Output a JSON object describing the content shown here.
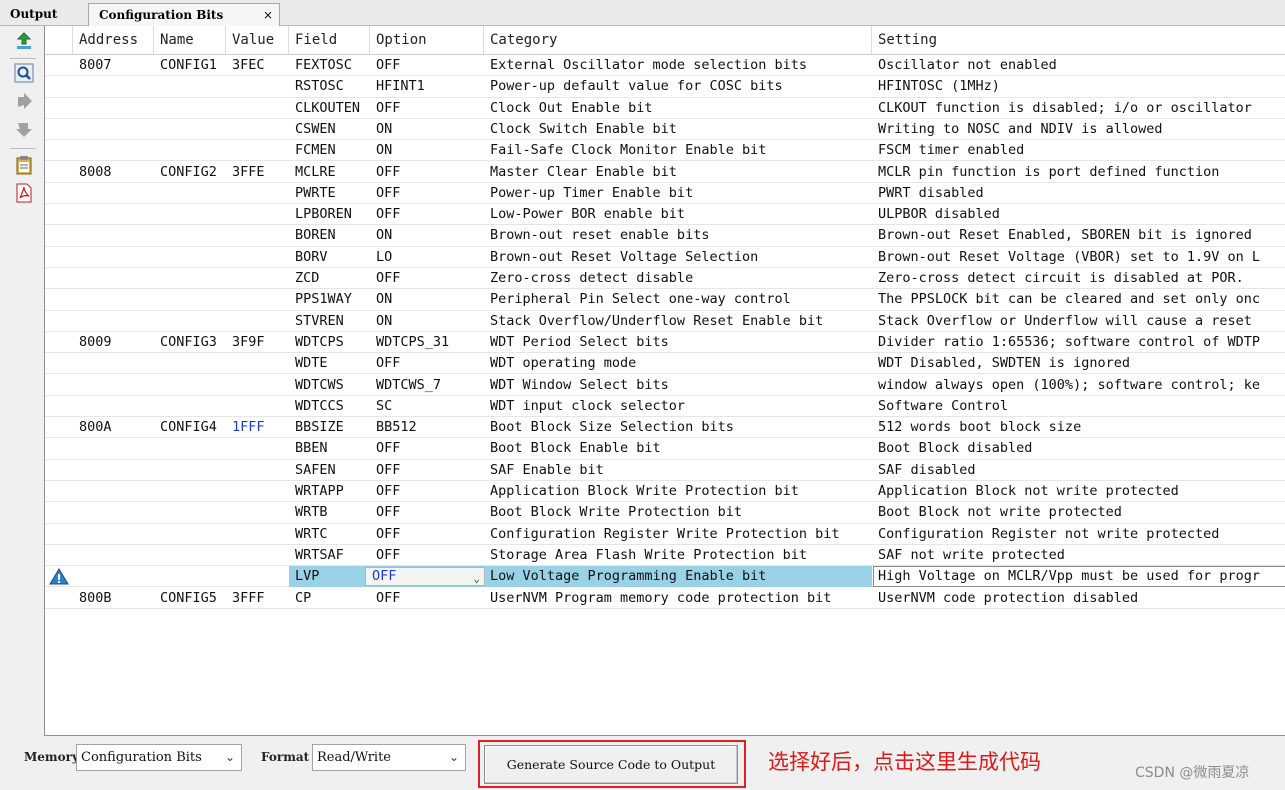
{
  "tabs": [
    {
      "label": "Output"
    },
    {
      "label": "Configuration Bits",
      "close": "×"
    }
  ],
  "columns": [
    "Address",
    "Name",
    "Value",
    "Field",
    "Option",
    "Category",
    "Setting"
  ],
  "rows": [
    {
      "address": "8007",
      "name": "CONFIG1",
      "value": "3FEC",
      "field": "FEXTOSC",
      "option": "OFF",
      "category": "External Oscillator mode selection bits",
      "setting": "Oscillator not enabled"
    },
    {
      "address": "",
      "name": "",
      "value": "",
      "field": "RSTOSC",
      "option": "HFINT1",
      "category": "Power-up default value for COSC bits",
      "setting": "HFINTOSC (1MHz)"
    },
    {
      "address": "",
      "name": "",
      "value": "",
      "field": "CLKOUTEN",
      "option": "OFF",
      "category": "Clock Out Enable bit",
      "setting": "CLKOUT function is disabled; i/o or oscillator"
    },
    {
      "address": "",
      "name": "",
      "value": "",
      "field": "CSWEN",
      "option": "ON",
      "category": "Clock Switch Enable bit",
      "setting": "Writing to NOSC and NDIV is allowed"
    },
    {
      "address": "",
      "name": "",
      "value": "",
      "field": "FCMEN",
      "option": "ON",
      "category": "Fail-Safe Clock Monitor Enable bit",
      "setting": "FSCM timer enabled"
    },
    {
      "address": "8008",
      "name": "CONFIG2",
      "value": "3FFE",
      "field": "MCLRE",
      "option": "OFF",
      "category": "Master Clear Enable bit",
      "setting": "MCLR pin function is port defined function"
    },
    {
      "address": "",
      "name": "",
      "value": "",
      "field": "PWRTE",
      "option": "OFF",
      "category": "Power-up Timer Enable bit",
      "setting": "PWRT disabled"
    },
    {
      "address": "",
      "name": "",
      "value": "",
      "field": "LPBOREN",
      "option": "OFF",
      "category": "Low-Power BOR enable bit",
      "setting": "ULPBOR disabled"
    },
    {
      "address": "",
      "name": "",
      "value": "",
      "field": "BOREN",
      "option": "ON",
      "category": "Brown-out reset enable bits",
      "setting": "Brown-out Reset Enabled, SBOREN bit is ignored"
    },
    {
      "address": "",
      "name": "",
      "value": "",
      "field": "BORV",
      "option": "LO",
      "category": "Brown-out Reset Voltage Selection",
      "setting": "Brown-out Reset Voltage (VBOR) set to 1.9V on L"
    },
    {
      "address": "",
      "name": "",
      "value": "",
      "field": "ZCD",
      "option": "OFF",
      "category": "Zero-cross detect disable",
      "setting": "Zero-cross detect circuit is disabled at POR."
    },
    {
      "address": "",
      "name": "",
      "value": "",
      "field": "PPS1WAY",
      "option": "ON",
      "category": "Peripheral Pin Select one-way control",
      "setting": "The PPSLOCK bit can be cleared and set only onc"
    },
    {
      "address": "",
      "name": "",
      "value": "",
      "field": "STVREN",
      "option": "ON",
      "category": "Stack Overflow/Underflow Reset Enable bit",
      "setting": "Stack Overflow or Underflow will cause a reset"
    },
    {
      "address": "8009",
      "name": "CONFIG3",
      "value": "3F9F",
      "field": "WDTCPS",
      "option": "WDTCPS_31",
      "category": "WDT Period Select bits",
      "setting": "Divider ratio 1:65536; software control of WDTP"
    },
    {
      "address": "",
      "name": "",
      "value": "",
      "field": "WDTE",
      "option": "OFF",
      "category": "WDT operating mode",
      "setting": "WDT Disabled, SWDTEN is ignored"
    },
    {
      "address": "",
      "name": "",
      "value": "",
      "field": "WDTCWS",
      "option": "WDTCWS_7",
      "category": "WDT Window Select bits",
      "setting": "window always open (100%); software control; ke"
    },
    {
      "address": "",
      "name": "",
      "value": "",
      "field": "WDTCCS",
      "option": "SC",
      "category": "WDT input clock selector",
      "setting": "Software Control"
    },
    {
      "address": "800A",
      "name": "CONFIG4",
      "value": "1FFF",
      "field": "BBSIZE",
      "option": "BB512",
      "category": "Boot Block Size Selection bits",
      "setting": "512 words boot block size"
    },
    {
      "address": "",
      "name": "",
      "value": "",
      "field": "BBEN",
      "option": "OFF",
      "category": "Boot Block Enable bit",
      "setting": "Boot Block disabled"
    },
    {
      "address": "",
      "name": "",
      "value": "",
      "field": "SAFEN",
      "option": "OFF",
      "category": "SAF Enable bit",
      "setting": "SAF disabled"
    },
    {
      "address": "",
      "name": "",
      "value": "",
      "field": "WRTAPP",
      "option": "OFF",
      "category": "Application Block Write Protection bit",
      "setting": "Application Block not write protected"
    },
    {
      "address": "",
      "name": "",
      "value": "",
      "field": "WRTB",
      "option": "OFF",
      "category": "Boot Block Write Protection bit",
      "setting": "Boot Block not write protected"
    },
    {
      "address": "",
      "name": "",
      "value": "",
      "field": "WRTC",
      "option": "OFF",
      "category": "Configuration Register Write Protection bit",
      "setting": "Configuration Register not write protected"
    },
    {
      "address": "",
      "name": "",
      "value": "",
      "field": "WRTSAF",
      "option": "OFF",
      "category": "Storage Area Flash Write Protection bit",
      "setting": "SAF not write protected"
    },
    {
      "address": "",
      "name": "",
      "value": "",
      "field": "LVP",
      "option": "OFF",
      "category": "Low Voltage Programming Enable bit",
      "setting": "High Voltage on MCLR/Vpp must be used for progr"
    },
    {
      "address": "800B",
      "name": "CONFIG5",
      "value": "3FFF",
      "field": "CP",
      "option": "OFF",
      "category": "UserNVM Program memory code protection bit",
      "setting": "UserNVM code protection disabled"
    }
  ],
  "selected_row_index": 24,
  "highlight_value_row_index": 17,
  "toolbar_icons": [
    "export-icon",
    "search-icon",
    "move-down-icon",
    "move-up-icon",
    "clipboard-icon",
    "pdf-icon"
  ],
  "bottom": {
    "memory_label": "Memory",
    "memory_value": "Configuration Bits",
    "format_label": "Format",
    "format_value": "Read/Write",
    "generate_label": "Generate Source Code to Output"
  },
  "annotation": "选择好后，点击这里生成代码",
  "watermark": "CSDN @微雨夏凉",
  "colors": {
    "selection": "#99d2e6",
    "value_blue": "#2038d8",
    "annotation_red": "#e01818"
  }
}
